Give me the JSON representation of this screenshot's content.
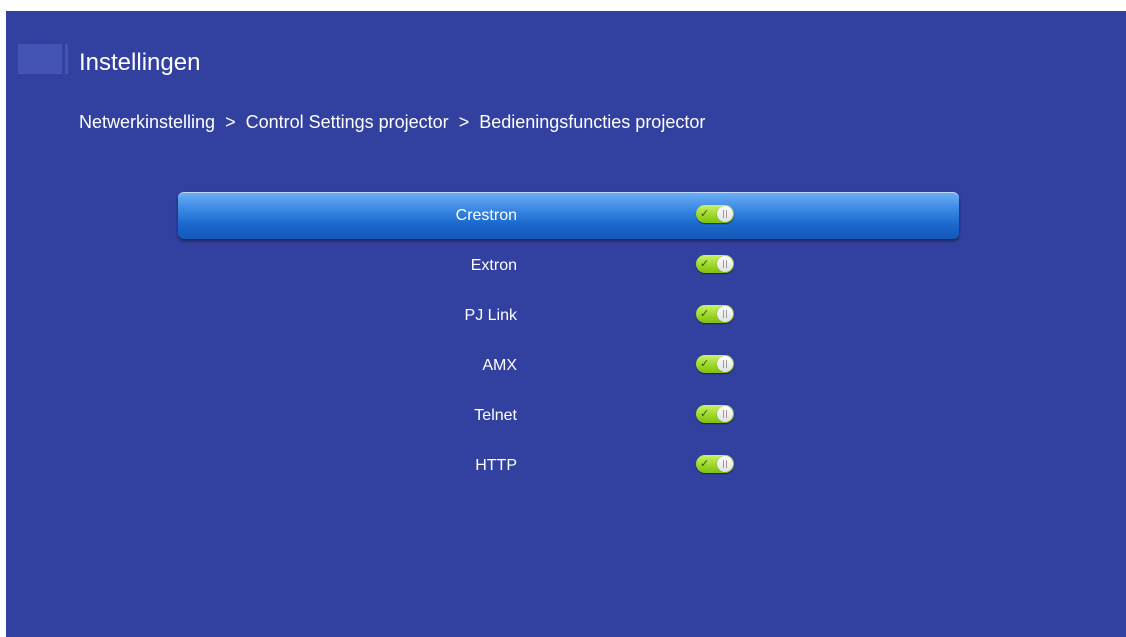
{
  "header": {
    "title": "Instellingen"
  },
  "breadcrumb": {
    "items": [
      "Netwerkinstelling",
      "Control Settings projector",
      "Bedieningsfuncties projector"
    ],
    "separator": ">"
  },
  "settings": {
    "selected_index": 0,
    "items": [
      {
        "label": "Crestron",
        "enabled": true
      },
      {
        "label": "Extron",
        "enabled": true
      },
      {
        "label": "PJ Link",
        "enabled": true
      },
      {
        "label": "AMX",
        "enabled": true
      },
      {
        "label": "Telnet",
        "enabled": true
      },
      {
        "label": "HTTP",
        "enabled": true
      }
    ]
  },
  "theme": {
    "background": "#3240a0",
    "highlight": "#3d8ae6",
    "toggle_on": "#9ad526",
    "text": "#ffffff"
  },
  "icons": {
    "toggle_check": "✓"
  }
}
